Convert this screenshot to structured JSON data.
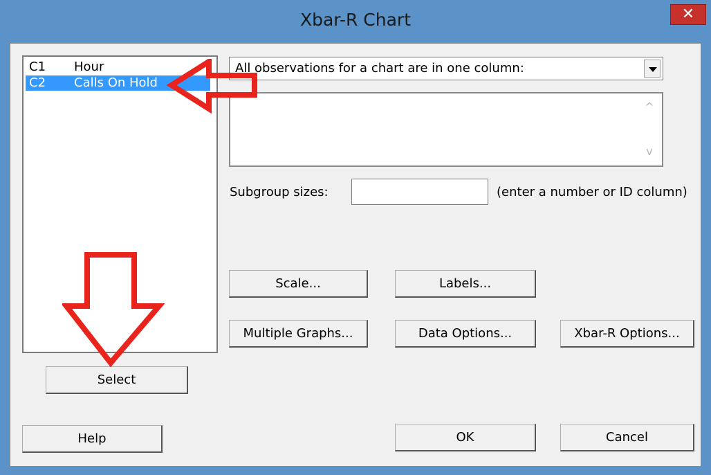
{
  "window": {
    "title": "Xbar-R Chart",
    "close_label": "✕"
  },
  "variables": [
    {
      "col": "C1",
      "name": "Hour",
      "selected": false
    },
    {
      "col": "C2",
      "name": "Calls On Hold",
      "selected": true
    }
  ],
  "chart_type_dropdown": {
    "value": "All observations for a chart are in one column:"
  },
  "subgroup": {
    "label": "Subgroup sizes:",
    "hint": "(enter a number or ID column)",
    "value": ""
  },
  "buttons": {
    "scale": "Scale...",
    "labels": "Labels...",
    "multiple_graphs": "Multiple Graphs...",
    "data_options": "Data Options...",
    "xbar_r_options": "Xbar-R Options...",
    "select": "Select",
    "help": "Help",
    "ok": "OK",
    "cancel": "Cancel"
  },
  "annotation_color": "#e8241c"
}
